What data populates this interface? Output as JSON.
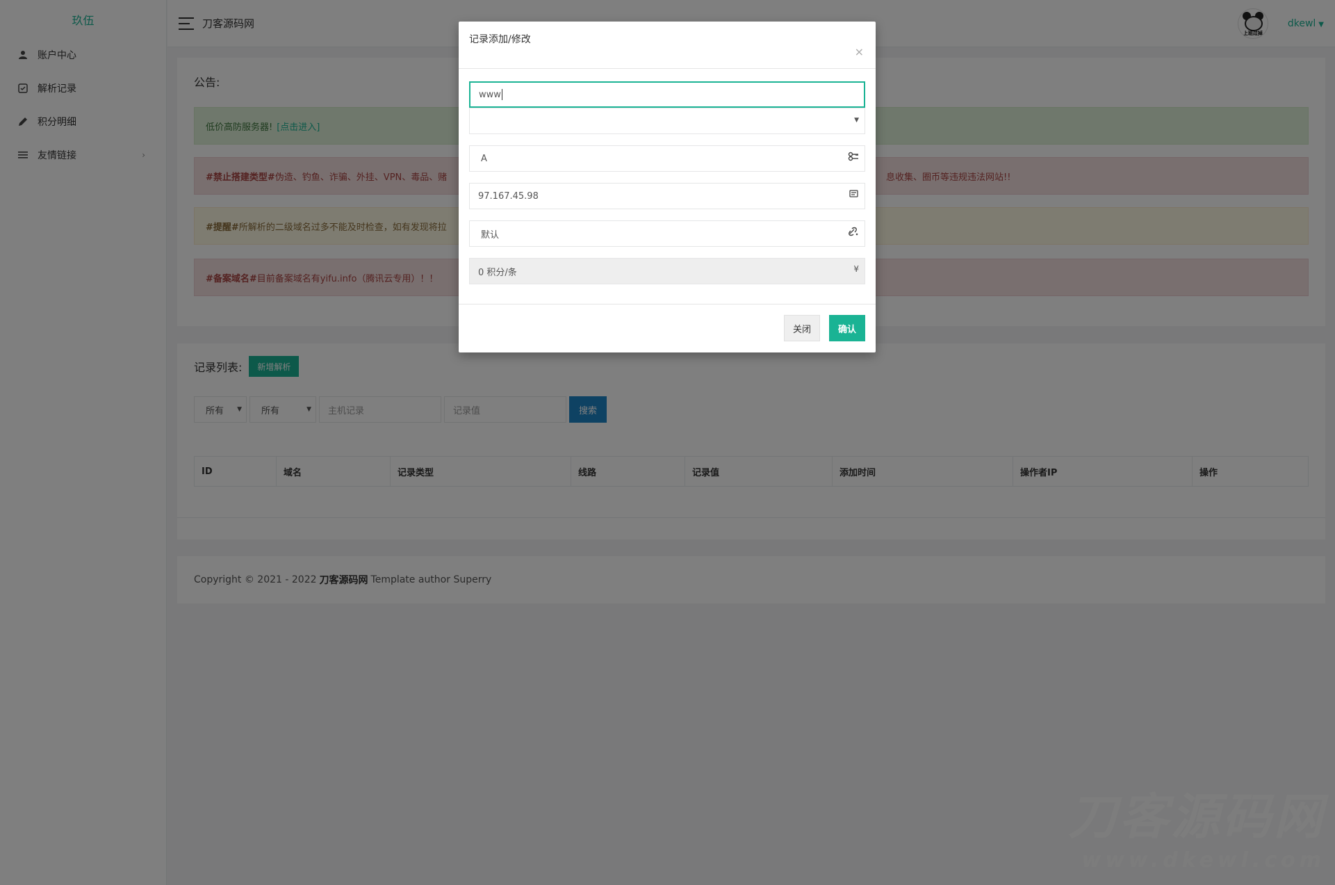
{
  "sidebar": {
    "logo_alt": "玖伍",
    "items": [
      {
        "label": "账户中心",
        "icon": "user-icon"
      },
      {
        "label": "解析记录",
        "icon": "record-icon"
      },
      {
        "label": "积分明细",
        "icon": "pencil-icon"
      },
      {
        "label": "友情链接",
        "icon": "list-icon",
        "arrow": "›"
      }
    ]
  },
  "header": {
    "site_name": "刀客源码网",
    "username": "dkewl",
    "avatar_caption": "上班过掉"
  },
  "notice": {
    "title": "公告:",
    "alerts": [
      {
        "text": "低价高防服务器!",
        "link": "[点击进入]"
      },
      {
        "tag": "#禁止搭建类型#",
        "text": " 伪造、钓鱼、诈骗、外挂、VPN、毒品、赌",
        "right_text": "息收集、圈币等违规违法网站!!"
      },
      {
        "tag": "#提醒#",
        "text": " 所解析的二级域名过多不能及时检查，如有发现将拉"
      },
      {
        "tag": "#备案域名#",
        "text": " 目前备案域名有yifu.info（腾讯云专用）！！"
      }
    ]
  },
  "records": {
    "title": "记录列表:",
    "add_button": "新增解析",
    "filter_type": "所有",
    "filter_line": "所有",
    "host_placeholder": "主机记录",
    "value_placeholder": "记录值",
    "search_button": "搜索",
    "columns": [
      "ID",
      "域名",
      "记录类型",
      "线路",
      "记录值",
      "添加时间",
      "操作者IP",
      "操作"
    ]
  },
  "footer": {
    "prefix": "Copyright © 2021 - 2022",
    "site": "刀客源码网",
    "suffix": "Template author Superry"
  },
  "watermark": {
    "line1": "刀客源码网",
    "line2": "www.dkewl.com"
  },
  "modal": {
    "title": "记录添加/修改",
    "close_symbol": "×",
    "host_value": "www",
    "domain_value": "",
    "type_value": "A",
    "ip_value": "97.167.45.98",
    "line_value": "默认",
    "cost_value": "0 积分/条",
    "cost_suffix": "¥",
    "close_button": "关闭",
    "confirm_button": "确认"
  }
}
